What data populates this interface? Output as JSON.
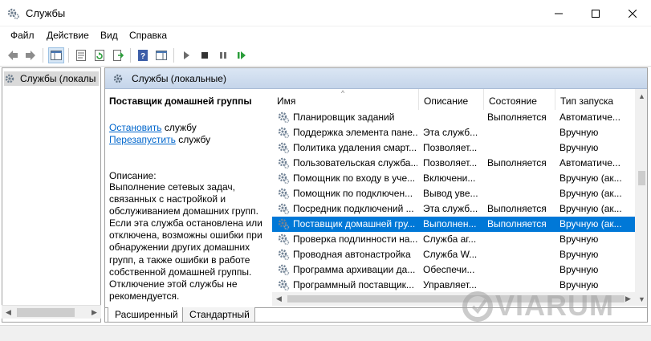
{
  "window": {
    "title": "Службы",
    "app_icon": "services-gear-icon",
    "controls": [
      "minimize-icon",
      "maximize-icon",
      "close-icon"
    ]
  },
  "menu": [
    "Файл",
    "Действие",
    "Вид",
    "Справка"
  ],
  "toolbar": {
    "icons": [
      "back-arrow-icon",
      "forward-arrow-icon",
      "show-tree-icon",
      "properties-icon",
      "refresh-icon",
      "export-list-icon",
      "help-icon",
      "action-pane-icon",
      "start-service-icon",
      "stop-service-icon",
      "pause-service-icon",
      "restart-service-icon"
    ]
  },
  "tree": {
    "item_label": "Службы (локалы"
  },
  "right_header": {
    "title": "Службы (локальные)"
  },
  "details": {
    "service_title": "Поставщик домашней группы",
    "stop_link": "Остановить",
    "stop_suffix": " службу",
    "restart_link": "Перезапустить",
    "restart_suffix": " службу",
    "description_label": "Описание:",
    "description_text": "Выполнение сетевых задач, связанных с настройкой и обслуживанием домашних групп. Если эта служба остановлена или отключена, возможны ошибки при обнаружении других домашних групп, а также ошибки в работе собственной домашней группы. Отключение этой службы не рекомендуется."
  },
  "columns": {
    "name": "Имя",
    "description": "Описание",
    "state": "Состояние",
    "startup": "Тип запуска"
  },
  "services": [
    {
      "name": "Планировщик заданий",
      "description": "",
      "state": "Выполняется",
      "startup": "Автоматиче..."
    },
    {
      "name": "Поддержка элемента пане...",
      "description": "Эта служб...",
      "state": "",
      "startup": "Вручную"
    },
    {
      "name": "Политика удаления смарт...",
      "description": "Позволяет...",
      "state": "",
      "startup": "Вручную"
    },
    {
      "name": "Пользовательская служба...",
      "description": "Позволяет...",
      "state": "Выполняется",
      "startup": "Автоматиче..."
    },
    {
      "name": "Помощник по входу в уче...",
      "description": "Включени...",
      "state": "",
      "startup": "Вручную (ак..."
    },
    {
      "name": "Помощник по подключен...",
      "description": "Вывод уве...",
      "state": "",
      "startup": "Вручную (ак..."
    },
    {
      "name": "Посредник подключений ...",
      "description": "Эта служб...",
      "state": "Выполняется",
      "startup": "Вручную (ак..."
    },
    {
      "name": "Поставщик домашней гру...",
      "description": "Выполнен...",
      "state": "Выполняется",
      "startup": "Вручную (ак...",
      "selected": true
    },
    {
      "name": "Проверка подлинности на...",
      "description": "Служба аг...",
      "state": "",
      "startup": "Вручную"
    },
    {
      "name": "Проводная автонастройка",
      "description": "Служба W...",
      "state": "",
      "startup": "Вручную"
    },
    {
      "name": "Программа архивации да...",
      "description": "Обеспечи...",
      "state": "",
      "startup": "Вручную"
    },
    {
      "name": "Программный поставщик...",
      "description": "Управляет...",
      "state": "",
      "startup": "Вручную"
    }
  ],
  "tabs": [
    "Расширенный",
    "Стандартный"
  ],
  "active_tab": "Расширенный",
  "watermark": "VIARUM",
  "colors": {
    "selection": "#0078d7",
    "link": "#0066cc",
    "header_gradient_top": "#dbe6f4",
    "header_gradient_bottom": "#c5d5ea"
  }
}
